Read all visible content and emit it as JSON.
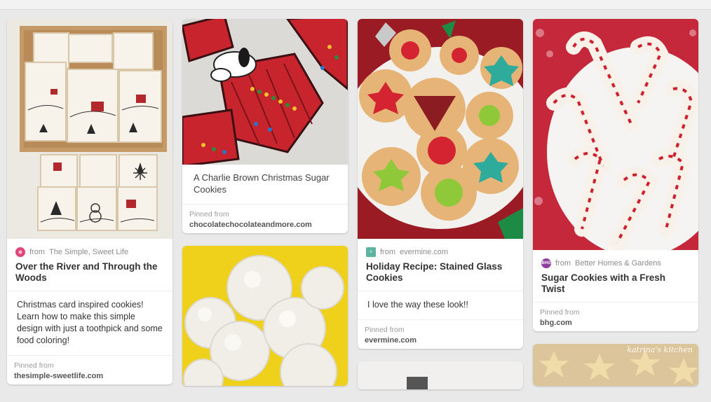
{
  "pins": [
    {
      "source_prefix": "from",
      "source_name": "The Simple, Sweet Life",
      "title": "Over the River and Through the Woods",
      "description": "Christmas card inspired cookies! Learn how to make this simple design with just a toothpick and some food coloring!",
      "pinned_label": "Pinned from",
      "pinned_domain": "thesimple-sweetlife.com",
      "icon": "pinterest-avatar-icon",
      "icon_color": "#e0457b"
    },
    {
      "title": "A Charlie Brown Christmas Sugar Cookies",
      "pinned_label": "Pinned from",
      "pinned_domain": "chocolatechocolateandmore.com"
    },
    {
      "source_prefix": "from",
      "source_name": "evermine.com",
      "title": "Holiday Recipe: Stained Glass Cookies",
      "description": "I love the way these look!!",
      "pinned_label": "Pinned from",
      "pinned_domain": "evermine.com",
      "icon": "evermine-icon",
      "icon_color": "#5bb3a0"
    },
    {
      "source_prefix": "from",
      "source_name": "Better Homes & Gardens",
      "title": "Sugar Cookies with a Fresh Twist",
      "pinned_label": "Pinned from",
      "pinned_domain": "bhg.com",
      "icon": "bhg-icon",
      "icon_color": "#8e3d9e",
      "icon_text": "BHG"
    }
  ],
  "watermark": "katrina's kitchen"
}
